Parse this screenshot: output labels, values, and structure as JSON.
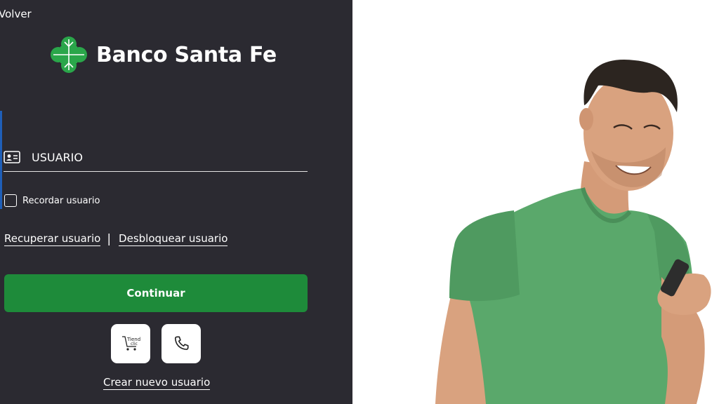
{
  "header": {
    "back_label": "Volver"
  },
  "brand": {
    "name": "Banco Santa Fe",
    "color": "#2aa64a"
  },
  "login": {
    "user_placeholder": "USUARIO",
    "user_icon": "id-card-icon",
    "remember_label": "Recordar usuario",
    "remember_checked": false,
    "recover_label": "Recuperar usuario",
    "separator": "|",
    "unlock_label": "Desbloquear usuario",
    "continue_label": "Continuar",
    "continue_color": "#1e8b3a",
    "create_label": "Crear nuevo usuario"
  },
  "quick_actions": {
    "tienda_line1": "Tienda",
    "tienda_line2": "clic",
    "tienda_icon": "cart-icon",
    "phone_icon": "phone-icon"
  },
  "theme": {
    "panel_bg": "#2b2a31",
    "accent": "#1f5fb8"
  }
}
